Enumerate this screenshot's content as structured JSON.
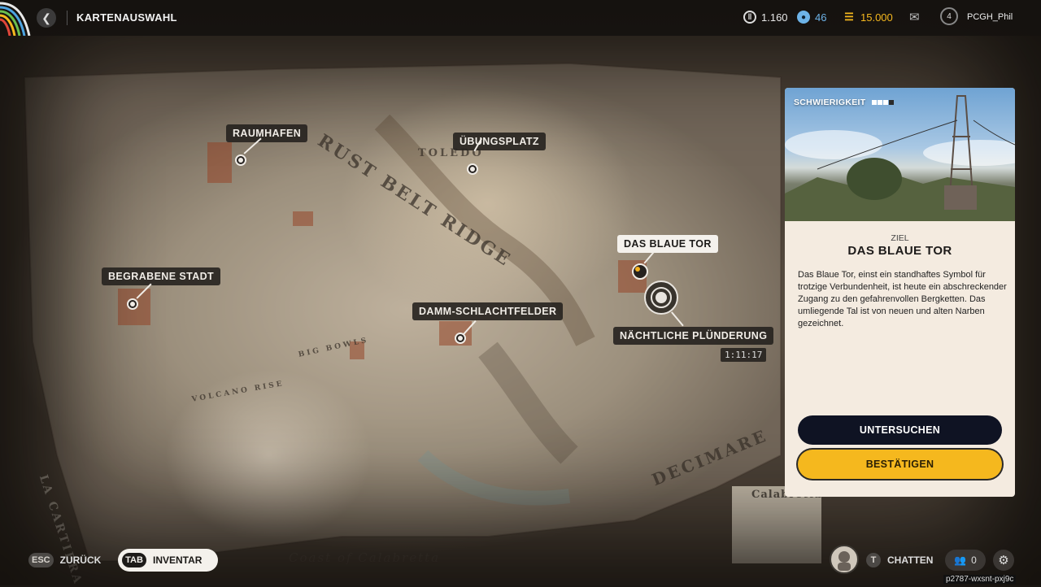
{
  "header": {
    "back_icon": "chevron-left-icon",
    "title": "KARTENAUSWAHL",
    "currencies": [
      {
        "icon": "silver-coin-icon",
        "value": "1.160",
        "color": "#e8e8e8"
      },
      {
        "icon": "blue-token-icon",
        "value": "46",
        "color": "#6db3e8"
      },
      {
        "icon": "gold-coin-icon",
        "value": "15.000",
        "color": "#f5b81e"
      }
    ],
    "mail_icon": "mail-icon",
    "level": "4",
    "username": "PCGH_Phil"
  },
  "map": {
    "region_labels": [
      {
        "text": "RUST BELT RIDGE"
      },
      {
        "text": "DECIMARE"
      },
      {
        "text": "LA CARTIERA"
      },
      {
        "text": "Coast of Calabretta"
      },
      {
        "text": "VOLCANO RISE"
      },
      {
        "text": "BIG BOWLS"
      },
      {
        "text": "TOLEDO"
      },
      {
        "text": "Calabretta"
      }
    ],
    "locations": [
      {
        "name": "RAUMHAFEN",
        "active": false
      },
      {
        "name": "ÜBUNGSPLATZ",
        "active": false
      },
      {
        "name": "BEGRABENE STADT",
        "active": false
      },
      {
        "name": "DAMM-SCHLACHTFELDER",
        "active": false
      },
      {
        "name": "DAS BLAUE TOR",
        "active": true
      }
    ],
    "event": {
      "name": "NÄCHTLICHE PLÜNDERUNG",
      "timer": "1:11:17"
    }
  },
  "panel": {
    "difficulty_label": "SCHWIERIGKEIT",
    "difficulty_level": 3,
    "difficulty_max": 4,
    "objective_label": "ZIEL",
    "objective_title": "DAS BLAUE TOR",
    "objective_description": "Das Blaue Tor, einst ein standhaftes Symbol für trotzige Verbundenheit, ist heute ein abschreckender Zugang zu den gefahrenvollen Bergketten. Das umliegende Tal ist von neuen und alten Narben gezeichnet.",
    "btn_inspect": "UNTERSUCHEN",
    "btn_confirm": "BESTÄTIGEN"
  },
  "footer": {
    "back_key": "ESC",
    "back_label": "ZURÜCK",
    "inventory_key": "TAB",
    "inventory_label": "INVENTAR",
    "chat_key": "T",
    "chat_label": "CHATTEN",
    "friends_count": "0",
    "settings_icon": "gear-icon",
    "session_id": "p2787-wxsnt-pxj9c"
  }
}
